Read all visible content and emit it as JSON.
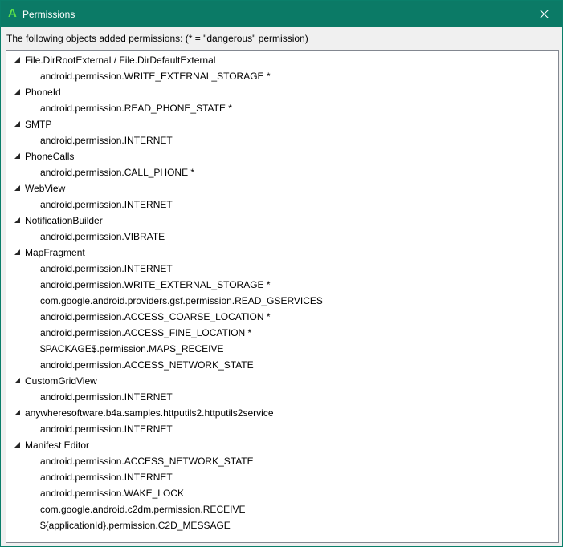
{
  "window": {
    "title": "Permissions",
    "app_icon_letter": "A"
  },
  "header": {
    "text": "The following objects added permissions: (* = \"dangerous\" permission)"
  },
  "tree": {
    "nodes": [
      {
        "label": "File.DirRootExternal / File.DirDefaultExternal",
        "children": [
          "android.permission.WRITE_EXTERNAL_STORAGE *"
        ]
      },
      {
        "label": "PhoneId",
        "children": [
          "android.permission.READ_PHONE_STATE *"
        ]
      },
      {
        "label": "SMTP",
        "children": [
          "android.permission.INTERNET"
        ]
      },
      {
        "label": "PhoneCalls",
        "children": [
          "android.permission.CALL_PHONE *"
        ]
      },
      {
        "label": "WebView",
        "children": [
          "android.permission.INTERNET"
        ]
      },
      {
        "label": "NotificationBuilder",
        "children": [
          "android.permission.VIBRATE"
        ]
      },
      {
        "label": "MapFragment",
        "children": [
          "android.permission.INTERNET",
          "android.permission.WRITE_EXTERNAL_STORAGE *",
          "com.google.android.providers.gsf.permission.READ_GSERVICES",
          "android.permission.ACCESS_COARSE_LOCATION *",
          "android.permission.ACCESS_FINE_LOCATION *",
          "$PACKAGE$.permission.MAPS_RECEIVE",
          "android.permission.ACCESS_NETWORK_STATE"
        ]
      },
      {
        "label": "CustomGridView",
        "children": [
          "android.permission.INTERNET"
        ]
      },
      {
        "label": "anywheresoftware.b4a.samples.httputils2.httputils2service",
        "children": [
          "android.permission.INTERNET"
        ]
      },
      {
        "label": "Manifest Editor",
        "children": [
          "android.permission.ACCESS_NETWORK_STATE",
          "android.permission.INTERNET",
          "android.permission.WAKE_LOCK",
          "com.google.android.c2dm.permission.RECEIVE",
          "${applicationId}.permission.C2D_MESSAGE"
        ]
      }
    ]
  },
  "colors": {
    "titlebar": "#0b7a66",
    "app_icon": "#5ce04a",
    "tree_border": "#828790"
  }
}
